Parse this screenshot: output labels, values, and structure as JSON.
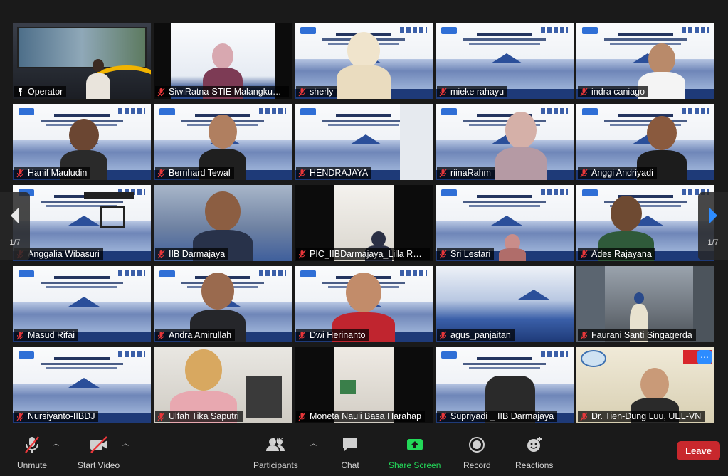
{
  "gallery": {
    "page_indicator_left": "1/7",
    "page_indicator_right": "1/7",
    "tiles": [
      {
        "name": "Operator",
        "muted": false,
        "pinned": true,
        "bg": "studio",
        "active": true
      },
      {
        "name": "SiwiRatna-STIE Malangkucecwara",
        "muted": true,
        "bg": "dark"
      },
      {
        "name": "sherly",
        "muted": true,
        "bg": "conf"
      },
      {
        "name": "mieke rahayu",
        "muted": true,
        "bg": "conf"
      },
      {
        "name": "indra caniago",
        "muted": true,
        "bg": "conf"
      },
      {
        "name": "Hanif Mauludin",
        "muted": true,
        "bg": "conf"
      },
      {
        "name": "Bernhard Tewal",
        "muted": true,
        "bg": "conf"
      },
      {
        "name": "HENDRAJAYA",
        "muted": true,
        "bg": "conf"
      },
      {
        "name": "riinaRahm",
        "muted": true,
        "bg": "conf"
      },
      {
        "name": "Anggi Andriyadi",
        "muted": true,
        "bg": "conf"
      },
      {
        "name": "Anggalia Wibasuri",
        "muted": true,
        "bg": "conf"
      },
      {
        "name": "IIB Darmajaya",
        "muted": true,
        "bg": "street"
      },
      {
        "name": "PIC_IIBDarmajaya_Lilla Rahmawati",
        "muted": true,
        "bg": "dark"
      },
      {
        "name": "Sri Lestari",
        "muted": true,
        "bg": "conf"
      },
      {
        "name": "Ades Rajayana",
        "muted": true,
        "bg": "conf"
      },
      {
        "name": "Masud Rifai",
        "muted": true,
        "bg": "conf"
      },
      {
        "name": "Andra Amirullah",
        "muted": true,
        "bg": "conf"
      },
      {
        "name": "Dwi Herinanto",
        "muted": true,
        "bg": "conf"
      },
      {
        "name": "agus_panjaitan",
        "muted": true,
        "bg": "conf"
      },
      {
        "name": "Faurani Santi Singagerda",
        "muted": true,
        "bg": "street"
      },
      {
        "name": "Nursiyanto-IIBDJ",
        "muted": true,
        "bg": "conf"
      },
      {
        "name": "Ulfah Tika Saputri",
        "muted": true,
        "bg": "room"
      },
      {
        "name": "Moneta Nauli Basa Harahap",
        "muted": true,
        "bg": "dark"
      },
      {
        "name": "Supriyadi _ IIB Darmajaya",
        "muted": true,
        "bg": "conf"
      },
      {
        "name": "Dr. Tien-Dung Luu, UEL-VN",
        "muted": true,
        "bg": "room",
        "more": true
      }
    ]
  },
  "toolbar": {
    "unmute": "Unmute",
    "start_video": "Start Video",
    "participants": "Participants",
    "participant_count": "161",
    "chat": "Chat",
    "share_screen": "Share Screen",
    "record": "Record",
    "reactions": "Reactions",
    "leave": "Leave"
  },
  "colors": {
    "active_speaker": "#c5e63b",
    "muted_red": "#e8373a",
    "share_green": "#23d959",
    "leave_red": "#c8282d",
    "accent_blue": "#2d8cff"
  },
  "icons": [
    "microphone-muted-icon",
    "video-off-icon",
    "participants-icon",
    "chat-icon",
    "share-screen-icon",
    "record-icon",
    "reactions-icon",
    "pin-icon",
    "chevron-left-icon",
    "chevron-right-icon"
  ]
}
